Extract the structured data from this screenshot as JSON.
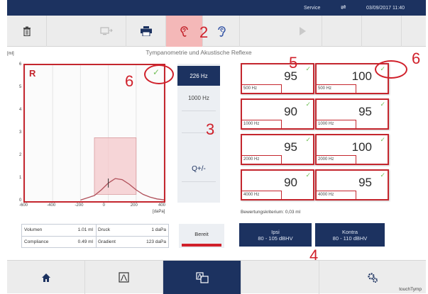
{
  "status": {
    "service": "Service",
    "usb_icon": "usb-icon",
    "datetime": "03/09/2017  11:40"
  },
  "toolbar": {
    "delete_icon": "trash-icon",
    "transfer_icon": "monitor-transfer-icon",
    "print_icon": "printer-icon",
    "right_ear_icon": "ear-right-icon",
    "left_ear_icon": "ear-left-icon",
    "play_icon": "play-icon"
  },
  "title": "Tympanometrie und Akustische Reflexe",
  "chart_data": {
    "type": "line",
    "title": "Tympanometrie und Akustische Reflexe",
    "ear": "R",
    "ylabel": "[ml]",
    "xlabel": "[daPa]",
    "ylim": [
      0,
      6
    ],
    "xlim": [
      -600,
      400
    ],
    "yticks": [
      "0",
      "1",
      "2",
      "3",
      "4",
      "5",
      "6"
    ],
    "xticks": [
      "-600",
      "-400",
      "-200",
      "0",
      "200",
      "400"
    ],
    "series": [
      {
        "x": [
          -200,
          -100,
          -50,
          0,
          50,
          100,
          150,
          200,
          250,
          300,
          350,
          400
        ],
        "y": [
          0.05,
          0.25,
          0.5,
          0.8,
          1.0,
          0.95,
          0.75,
          0.5,
          0.3,
          0.18,
          0.1,
          0.06
        ]
      }
    ],
    "normal_region": {
      "x": [
        -100,
        200
      ],
      "y": [
        0.3,
        2.8
      ]
    },
    "colors": {
      "curve": "#b0505a",
      "region": "#f4c8cb",
      "border": "#c4262e"
    }
  },
  "frequencies": [
    "226 Hz",
    "1000 Hz"
  ],
  "zoom_label": "Q+/-",
  "reflexes": [
    {
      "value": "95",
      "freq": "500 Hz"
    },
    {
      "value": "100",
      "freq": "500 Hz"
    },
    {
      "value": "90",
      "freq": "1000 Hz"
    },
    {
      "value": "95",
      "freq": "1000 Hz"
    },
    {
      "value": "95",
      "freq": "2000 Hz"
    },
    {
      "value": "100",
      "freq": "2000 Hz"
    },
    {
      "value": "90",
      "freq": "4000 Hz"
    },
    {
      "value": "95",
      "freq": "4000 Hz"
    }
  ],
  "criterion": "Bewertungskriterium: 0,03 ml",
  "measures": {
    "volumen_label": "Volumen",
    "volumen_value": "1.01 ml",
    "druck_label": "Druck",
    "druck_value": "1 daPa",
    "compliance_label": "Compliance",
    "compliance_value": "0.49 ml",
    "gradient_label": "Gradient",
    "gradient_value": "123 daPa"
  },
  "bereit": "Bereit",
  "ipsi": {
    "title": "Ipsi",
    "range": "80 - 105 dBHV"
  },
  "kontra": {
    "title": "Kontra",
    "range": "80 - 110 dBHV"
  },
  "annotations": {
    "a2": "2",
    "a3": "3",
    "a4": "4",
    "a5": "5",
    "a6a": "6",
    "a6b": "6"
  },
  "bottom": {
    "home_icon": "home-icon",
    "chart_icon": "chart-icon",
    "screens_icon": "screens-icon",
    "settings_icon": "settings-icon",
    "brand": "touchTymp"
  }
}
